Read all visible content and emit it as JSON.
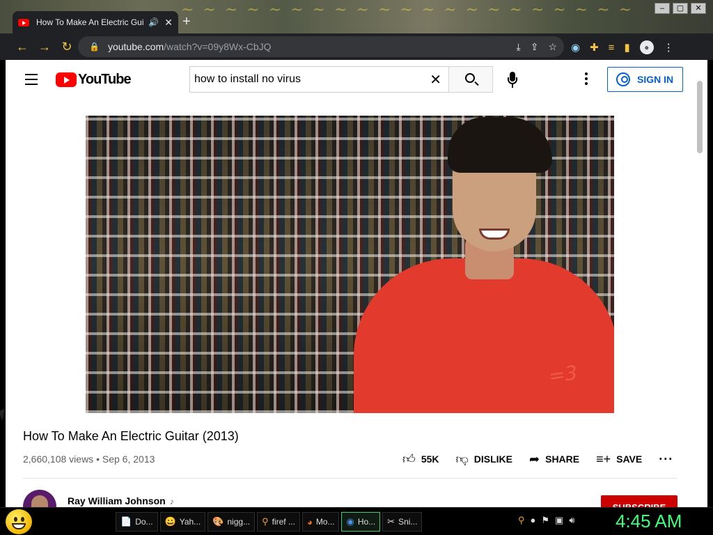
{
  "browser": {
    "tab_title": "How To Make An Electric Gui",
    "url_host": "youtube.com",
    "url_path": "/watch?v=09y8Wx-CbJQ",
    "window_controls": [
      "–",
      "▢",
      "✕"
    ]
  },
  "youtube": {
    "logo_text": "YouTube",
    "search_value": "how to install no virus",
    "sign_in_label": "SIGN IN"
  },
  "video": {
    "shirt_text": "=3",
    "title": "How To Make An Electric Guitar (2013)",
    "views": "2,660,108 views",
    "separator": "•",
    "date": "Sep 6, 2013",
    "likes": "55K",
    "dislike_label": "DISLIKE",
    "share_label": "SHARE",
    "save_label": "SAVE",
    "channel_name": "Ray William Johnson",
    "subscribe_label": "SUBSCRIBE"
  },
  "taskbar": {
    "tasks": [
      {
        "icon": "document-icon",
        "label": "Do..."
      },
      {
        "icon": "smiley-icon",
        "label": "Yah..."
      },
      {
        "icon": "paint-icon",
        "label": "nigg..."
      },
      {
        "icon": "search-icon",
        "label": "firef ..."
      },
      {
        "icon": "firefox-icon",
        "label": "Mo..."
      },
      {
        "icon": "chrome-icon",
        "label": "Ho..."
      },
      {
        "icon": "snipping-icon",
        "label": "Sni..."
      }
    ],
    "clock": "4:45 AM"
  }
}
